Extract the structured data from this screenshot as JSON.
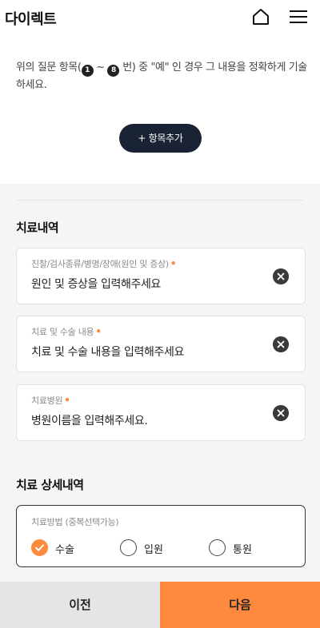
{
  "header": {
    "title": "다이렉트",
    "home_icon": "home-icon",
    "menu_icon": "hamburger-menu-icon"
  },
  "notice": {
    "part1": "위의 질문 항목(",
    "badge_from": "1",
    "tilde": " ~ ",
    "badge_to": "8",
    "part2": " 번) 중 \"예\" 인 경우 그 내용을 정확하게 기술하세요."
  },
  "add_button": {
    "label": "+ 항목추가"
  },
  "treatment": {
    "title": "치료내역",
    "fields": [
      {
        "label": "진찰/검사종류/병명/장애(원인 및 증상)",
        "value": "원인 및 증상을 입력해주세요"
      },
      {
        "label": "치료 및 수술 내용",
        "value": "치료 및 수술 내용을 입력해주세요"
      },
      {
        "label": "치료병원",
        "value": "병원이름을 입력해주세요."
      }
    ],
    "required_mark": "•"
  },
  "details": {
    "title": "치료 상세내역",
    "method_label": "치료방법 (중복선택가능)",
    "options": [
      {
        "label": "수술",
        "checked": true
      },
      {
        "label": "입원",
        "checked": false
      },
      {
        "label": "통원",
        "checked": false
      }
    ]
  },
  "footer": {
    "prev_label": "이전",
    "next_label": "다음"
  },
  "colors": {
    "accent": "#ff8a3d",
    "dark": "#1a2333",
    "gray_bg": "#f5f5f5"
  }
}
